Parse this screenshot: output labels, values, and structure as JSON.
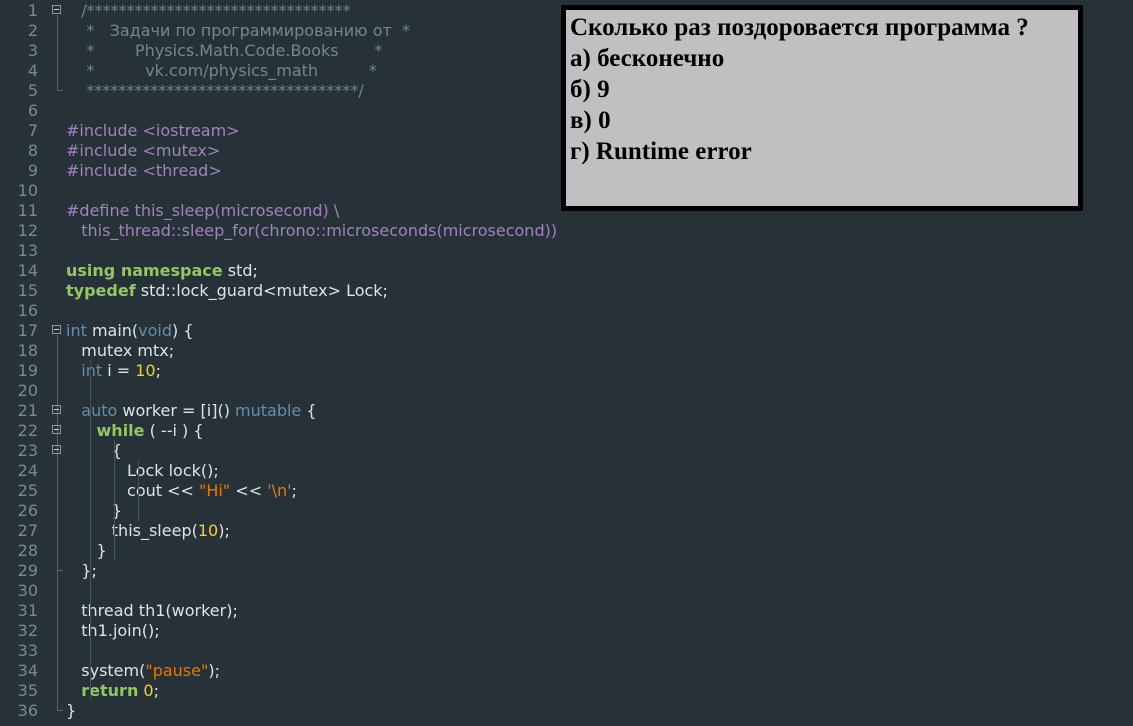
{
  "editor": {
    "line_numbers": [
      "1",
      "2",
      "3",
      "4",
      "5",
      "6",
      "7",
      "8",
      "9",
      "10",
      "11",
      "12",
      "13",
      "14",
      "15",
      "16",
      "17",
      "18",
      "19",
      "20",
      "21",
      "22",
      "23",
      "24",
      "25",
      "26",
      "27",
      "28",
      "29",
      "30",
      "31",
      "32",
      "33",
      "34",
      "35",
      "36"
    ],
    "lines": [
      [
        {
          "t": "   /*********************************",
          "c": "comment"
        }
      ],
      [
        {
          "t": "    *   Задачи по программированию от  *",
          "c": "comment"
        }
      ],
      [
        {
          "t": "    *        Physics.Math.Code.Books       *",
          "c": "comment"
        }
      ],
      [
        {
          "t": "    *          vk.com/physics_math          *",
          "c": "comment"
        }
      ],
      [
        {
          "t": "    **********************************/",
          "c": "comment"
        }
      ],
      [],
      [
        {
          "t": "#include <iostream>",
          "c": "pre"
        }
      ],
      [
        {
          "t": "#include <mutex>",
          "c": "pre"
        }
      ],
      [
        {
          "t": "#include <thread>",
          "c": "pre"
        }
      ],
      [],
      [
        {
          "t": "#define this_sleep(microsecond) \\",
          "c": "pre"
        }
      ],
      [
        {
          "t": "   this_thread::sleep_for(chrono::microseconds(microsecond))",
          "c": "pre"
        }
      ],
      [],
      [
        {
          "t": "using namespace",
          "c": "kw"
        },
        {
          "t": " std;",
          "c": "plain"
        }
      ],
      [
        {
          "t": "typedef",
          "c": "kw"
        },
        {
          "t": " std::lock_guard<mutex> Lock;",
          "c": "plain"
        }
      ],
      [],
      [
        {
          "t": "int",
          "c": "type"
        },
        {
          "t": " main(",
          "c": "plain"
        },
        {
          "t": "void",
          "c": "type"
        },
        {
          "t": ") {",
          "c": "plain"
        }
      ],
      [
        {
          "t": "   mutex mtx;",
          "c": "plain"
        }
      ],
      [
        {
          "t": "   ",
          "c": "plain"
        },
        {
          "t": "int",
          "c": "type"
        },
        {
          "t": " i = ",
          "c": "plain"
        },
        {
          "t": "10",
          "c": "num"
        },
        {
          "t": ";",
          "c": "plain"
        }
      ],
      [],
      [
        {
          "t": "   ",
          "c": "plain"
        },
        {
          "t": "auto",
          "c": "type"
        },
        {
          "t": " worker = [i]() ",
          "c": "plain"
        },
        {
          "t": "mutable",
          "c": "type"
        },
        {
          "t": " {",
          "c": "plain"
        }
      ],
      [
        {
          "t": "      ",
          "c": "plain"
        },
        {
          "t": "while",
          "c": "kw"
        },
        {
          "t": " ( --i ) {",
          "c": "plain"
        }
      ],
      [
        {
          "t": "         {",
          "c": "plain"
        }
      ],
      [
        {
          "t": "            Lock lock();",
          "c": "plain"
        }
      ],
      [
        {
          "t": "            cout << ",
          "c": "plain"
        },
        {
          "t": "\"Hi\"",
          "c": "str"
        },
        {
          "t": " << ",
          "c": "plain"
        },
        {
          "t": "'\\n'",
          "c": "str"
        },
        {
          "t": ";",
          "c": "plain"
        }
      ],
      [
        {
          "t": "         }",
          "c": "plain"
        }
      ],
      [
        {
          "t": "         this_sleep(",
          "c": "plain"
        },
        {
          "t": "10",
          "c": "num"
        },
        {
          "t": ");",
          "c": "plain"
        }
      ],
      [
        {
          "t": "      }",
          "c": "plain"
        }
      ],
      [
        {
          "t": "   };",
          "c": "plain"
        }
      ],
      [],
      [
        {
          "t": "   thread th1(worker);",
          "c": "plain"
        }
      ],
      [
        {
          "t": "   th1.join();",
          "c": "plain"
        }
      ],
      [],
      [
        {
          "t": "   system(",
          "c": "plain"
        },
        {
          "t": "\"pause\"",
          "c": "str"
        },
        {
          "t": ");",
          "c": "plain"
        }
      ],
      [
        {
          "t": "   ",
          "c": "plain"
        },
        {
          "t": "return",
          "c": "kw"
        },
        {
          "t": " ",
          "c": "plain"
        },
        {
          "t": "0",
          "c": "num"
        },
        {
          "t": ";",
          "c": "plain"
        }
      ],
      [
        {
          "t": "}",
          "c": "plain"
        }
      ]
    ]
  },
  "quiz": {
    "question": "Сколько раз поздоровается программа ?",
    "options": [
      "а) бесконечно",
      "б) 9",
      "в) 0",
      "г) Runtime error"
    ]
  },
  "colors": {
    "background": "#263238",
    "comment": "#74878f",
    "preprocessor": "#a082bd",
    "keyword": "#93c763",
    "type": "#678cb1",
    "number": "#ffcd22",
    "string": "#ec7600",
    "quiz_background": "#c0c0c0"
  }
}
